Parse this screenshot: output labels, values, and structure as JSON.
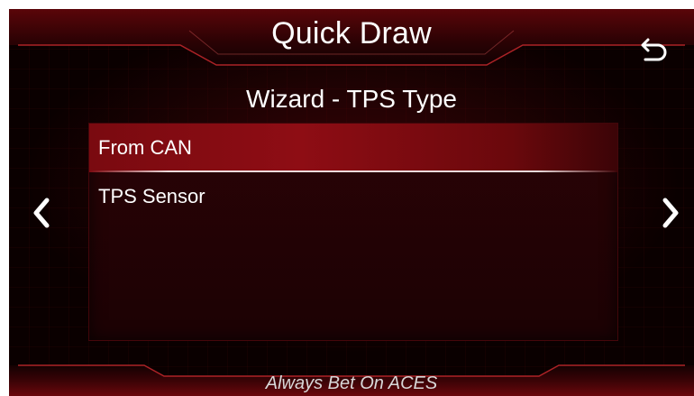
{
  "header": {
    "title": "Quick Draw"
  },
  "wizard": {
    "subtitle": "Wizard - TPS Type"
  },
  "options": [
    {
      "label": "From CAN",
      "selected": true
    },
    {
      "label": "TPS Sensor",
      "selected": false
    }
  ],
  "footer": {
    "tagline": "Always Bet On ACES"
  },
  "icons": {
    "back": "back-arrow-icon",
    "prev": "chevron-left-icon",
    "next": "chevron-right-icon"
  },
  "colors": {
    "accent": "#8e0d14",
    "background": "#0a0000",
    "text": "#ffffff"
  }
}
